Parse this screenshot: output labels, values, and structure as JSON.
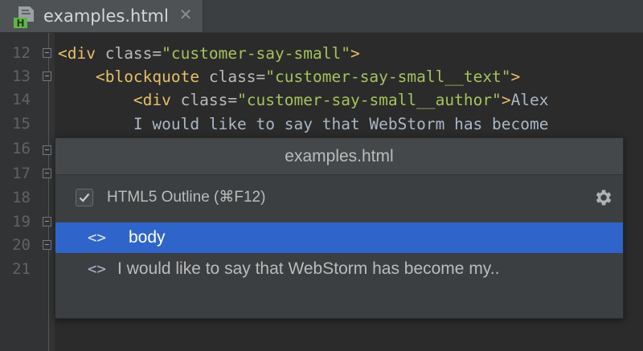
{
  "tab": {
    "title": "examples.html",
    "close_glyph": "✕",
    "file_icon_letter": "H"
  },
  "gutter": {
    "line_numbers": [
      "12",
      "13",
      "14",
      "15",
      "16",
      "17",
      "18",
      "19",
      "20",
      "21"
    ]
  },
  "code": {
    "line12": {
      "open": "<div",
      "attr": " class=",
      "value": "\"customer-say-small\"",
      "close": ">"
    },
    "line13": {
      "indent": "    ",
      "open": "<blockquote",
      "attr": " class=",
      "value": "\"customer-say-small__text\"",
      "close": ">"
    },
    "line14": {
      "indent": "        ",
      "open": "<div",
      "attr": " class=",
      "value": "\"customer-say-small__author\"",
      "close": ">",
      "text": "Alex"
    },
    "line15": {
      "indent": "        ",
      "text": "I would like to say that WebStorm has become"
    }
  },
  "popup": {
    "title": "examples.html",
    "outline_label": "HTML5 Outline (⌘F12)",
    "outline_checked": true,
    "settings_icon": "gear-icon",
    "items": [
      {
        "icon": "<>",
        "label": "body",
        "selected": true
      },
      {
        "icon": "<>",
        "label": "I would like to say that WebStorm has become my.."
      }
    ]
  },
  "colors": {
    "editor_bg": "#2b2b2b",
    "tag": "#e8bf6a",
    "attribute_value": "#a5c25c",
    "selection": "#2f65ca"
  }
}
